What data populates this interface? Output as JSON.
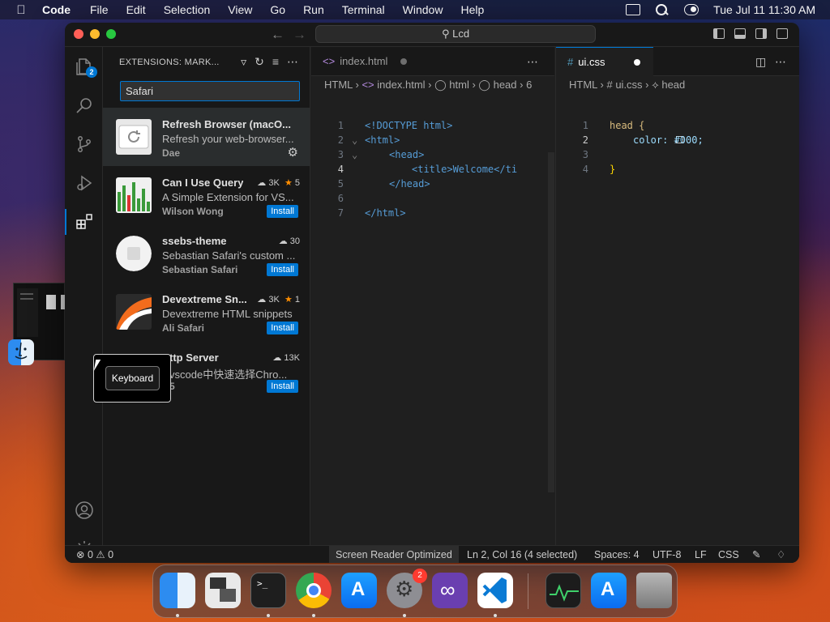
{
  "menubar": {
    "app": "Code",
    "items": [
      "File",
      "Edit",
      "Selection",
      "View",
      "Go",
      "Run",
      "Terminal",
      "Window",
      "Help"
    ],
    "datetime": "Tue Jul 11  11:30 AM"
  },
  "titlebar": {
    "command_center": "Lcd"
  },
  "activity_bar": {
    "explorer_badge": "2",
    "manage_badge": "1"
  },
  "sidebar": {
    "title": "EXTENSIONS: MARK...",
    "search_value": "Safari",
    "extensions": [
      {
        "name": "Refresh Browser (macO...",
        "description": "Refresh your web-browser...",
        "author": "Dae",
        "downloads": "",
        "rating": "",
        "action": ""
      },
      {
        "name": "Can I Use Query",
        "description": "A Simple Extension for VS...",
        "author": "Wilson Wong",
        "downloads": "3K",
        "rating": "5",
        "action": "Install"
      },
      {
        "name": "ssebs-theme",
        "description": "Sebastian Safari's custom ...",
        "author": "Sebastian Safari",
        "downloads": "30",
        "rating": "",
        "action": "Install"
      },
      {
        "name": "Devextreme Sn...",
        "description": "Devextreme HTML snippets",
        "author": "Ali Safari",
        "downloads": "3K",
        "rating": "1",
        "action": "Install"
      },
      {
        "name": "ttp Server",
        "description": "vscode中快速选择Chro...",
        "author": "5",
        "downloads": "13K",
        "rating": "",
        "action": "Install"
      }
    ]
  },
  "editor_left": {
    "tab_label": "index.html",
    "breadcrumb": [
      "HTML",
      "index.html",
      "html",
      "head",
      "6"
    ],
    "lines": [
      {
        "n": "1",
        "text": "<!DOCTYPE html>"
      },
      {
        "n": "2",
        "text": "<html>"
      },
      {
        "n": "3",
        "text": "<head>"
      },
      {
        "n": "4",
        "text": "<title>Welcome</ti"
      },
      {
        "n": "5",
        "text": "</head>"
      },
      {
        "n": "6",
        "text": ""
      },
      {
        "n": "7",
        "text": "</html>"
      }
    ]
  },
  "editor_right": {
    "tab_label": "ui.css",
    "breadcrumb": [
      "HTML",
      "ui.css",
      "head"
    ],
    "lines": [
      {
        "n": "1",
        "text": "head {"
      },
      {
        "n": "2",
        "text": "color: #000;"
      },
      {
        "n": "3",
        "text": ""
      },
      {
        "n": "4",
        "text": "}"
      }
    ]
  },
  "tooltip": {
    "label": "Keyboard"
  },
  "statusbar": {
    "errors": "0",
    "warnings": "0",
    "screen_reader": "Screen Reader Optimized",
    "position": "Ln 2, Col 16 (4 selected)",
    "spaces": "Spaces: 4",
    "encoding": "UTF-8",
    "eol": "LF",
    "language": "CSS"
  },
  "dock": {
    "settings_badge": "2",
    "apps": [
      "finder-icon",
      "preview-icon",
      "terminal-icon",
      "chrome-icon",
      "app-store-icon",
      "system-settings-icon",
      "visual-studio-icon",
      "vscode-icon",
      "activity-monitor-icon",
      "app-store-icon",
      "trash-icon"
    ]
  },
  "colors": {
    "accent": "#0078d4",
    "editor_bg": "#1f1f1f",
    "sidebar_bg": "#181818",
    "star": "#ff8e00"
  }
}
